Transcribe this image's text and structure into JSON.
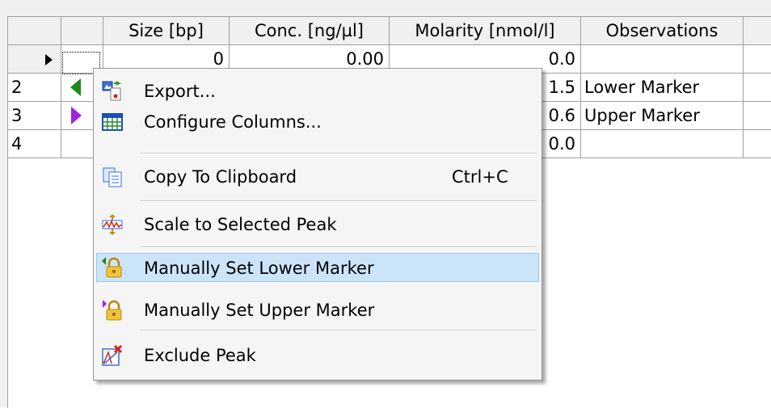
{
  "table": {
    "columns": [
      "",
      "",
      "Size [bp]",
      "Conc. [ng/µl]",
      "Molarity [nmol/l]",
      "Observations"
    ],
    "rows": [
      {
        "index": "",
        "size": "0",
        "conc": "0.00",
        "molarity": "0.0",
        "observation": ""
      },
      {
        "index": "2",
        "size": "",
        "conc": "",
        "molarity": "1.5",
        "observation": "Lower Marker"
      },
      {
        "index": "3",
        "size": "",
        "conc": "",
        "molarity": "0.6",
        "observation": "Upper Marker"
      },
      {
        "index": "4",
        "size": "",
        "conc": "",
        "molarity": "0.0",
        "observation": ""
      }
    ]
  },
  "context_menu": {
    "items": [
      {
        "label": "Export...",
        "icon": "export-icon",
        "shortcut": ""
      },
      {
        "label": "Configure Columns...",
        "icon": "table-columns-icon",
        "shortcut": ""
      },
      {
        "label": "Copy To Clipboard",
        "icon": "clipboard-icon",
        "shortcut": "Ctrl+C"
      },
      {
        "label": "Scale to Selected Peak",
        "icon": "scale-peak-icon",
        "shortcut": ""
      },
      {
        "label": "Manually Set Lower Marker",
        "icon": "lock-lower-marker-icon",
        "shortcut": ""
      },
      {
        "label": "Manually Set Upper Marker",
        "icon": "lock-upper-marker-icon",
        "shortcut": ""
      },
      {
        "label": "Exclude Peak",
        "icon": "exclude-peak-icon",
        "shortcut": ""
      }
    ],
    "highlighted": "Manually Set Lower Marker"
  },
  "colors": {
    "lower_marker": "#1e8a1e",
    "upper_marker": "#a020e0",
    "highlight": "#cce4f7"
  }
}
